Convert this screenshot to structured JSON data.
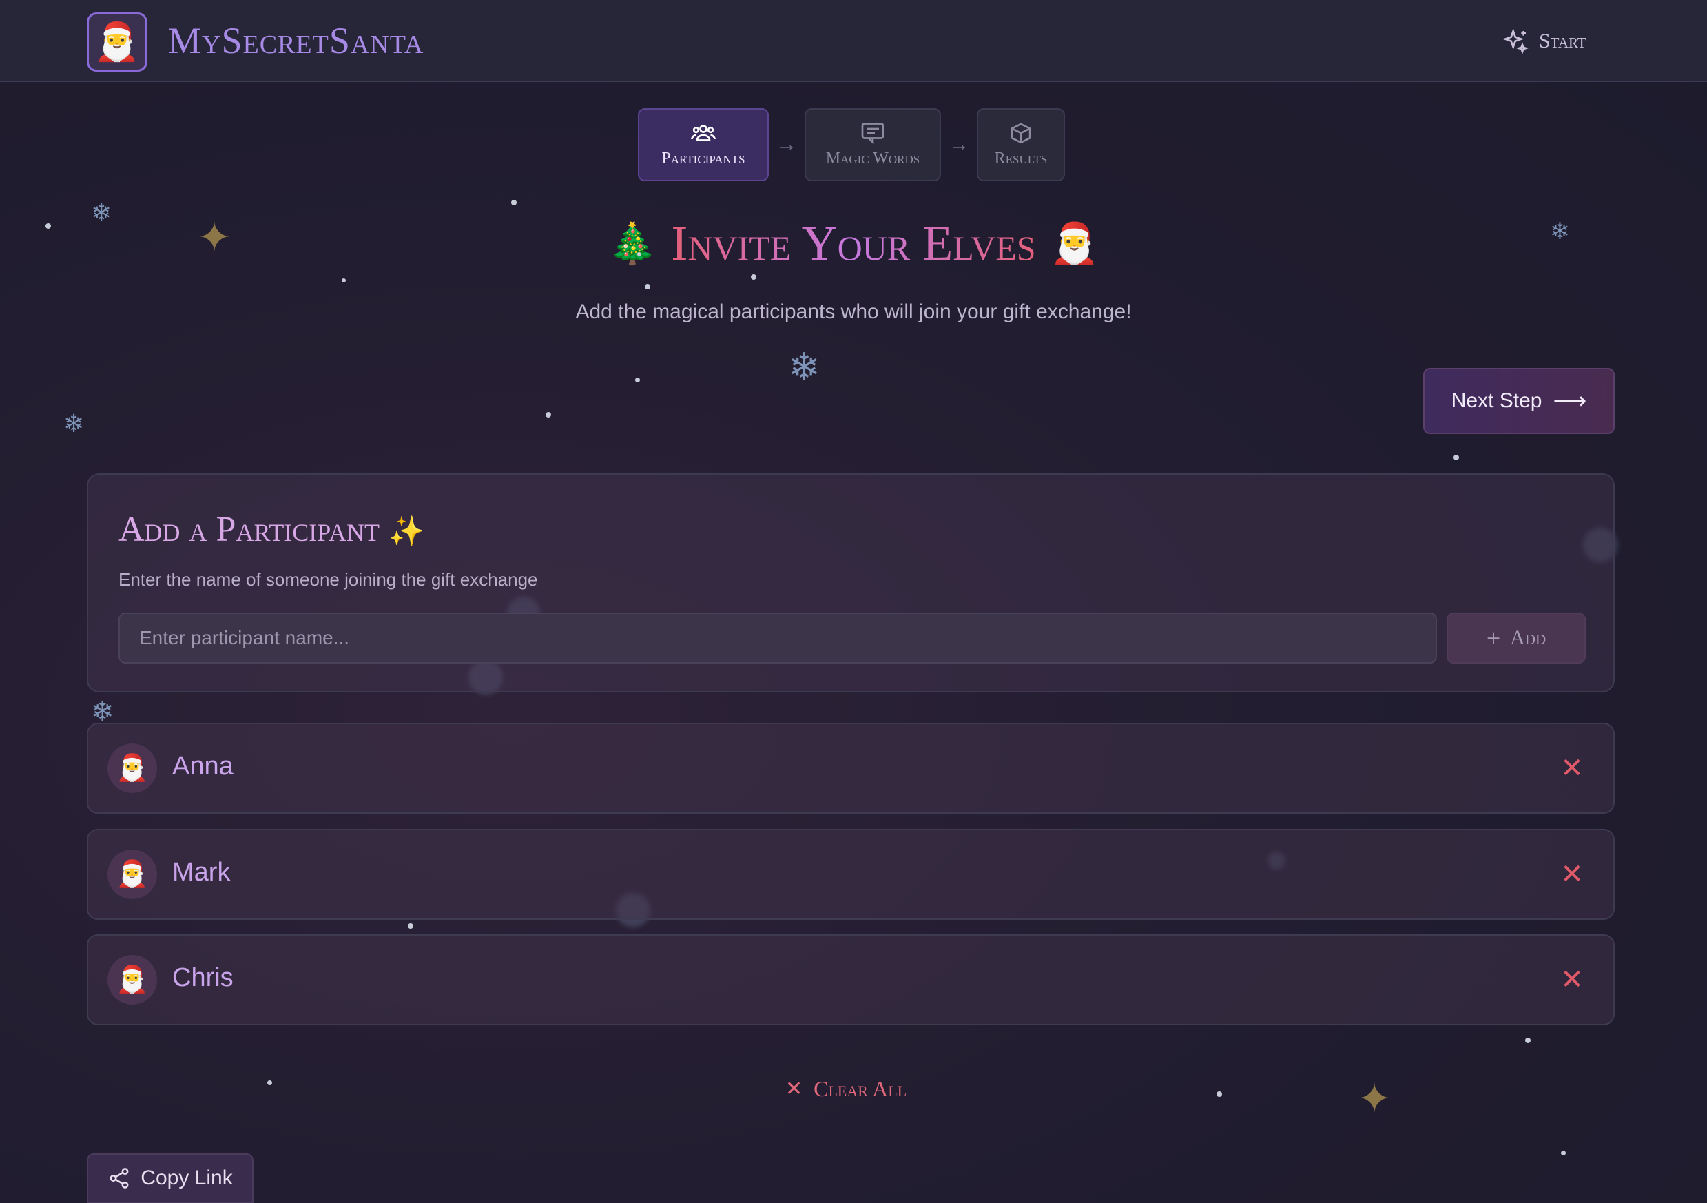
{
  "app": {
    "brand": "MySecretSanta",
    "logo_emoji": "🎅",
    "start_label": "Start"
  },
  "steps": [
    {
      "label": "Participants",
      "icon": "users-icon",
      "active": true
    },
    {
      "label": "Magic Words",
      "icon": "message-icon",
      "active": false
    },
    {
      "label": "Results",
      "icon": "box-icon",
      "active": false
    }
  ],
  "step_arrow": "→",
  "heading": {
    "prefix_emoji": "🎄",
    "title": "Invite Your Elves",
    "suffix_emoji": "🎅",
    "subtitle": "Add the magical participants who will join your gift exchange!"
  },
  "next_step": {
    "label": "Next Step",
    "arrow": "⟶"
  },
  "add_card": {
    "title": "Add a Participant",
    "title_emoji": "✨",
    "description": "Enter the name of someone joining the gift exchange",
    "input_placeholder": "Enter participant name...",
    "input_value": "",
    "add_label": "Add"
  },
  "participants": [
    {
      "name": "Anna",
      "avatar": "🎅"
    },
    {
      "name": "Mark",
      "avatar": "🎅"
    },
    {
      "name": "Chris",
      "avatar": "🎅"
    }
  ],
  "remove_glyph": "✕",
  "clear_all_label": "Clear All",
  "copy_link_label": "Copy Link",
  "colors": {
    "accent": "#a78ae6",
    "danger": "#e25a6a",
    "active_step": "#3b2c62",
    "background": "#221d30"
  }
}
